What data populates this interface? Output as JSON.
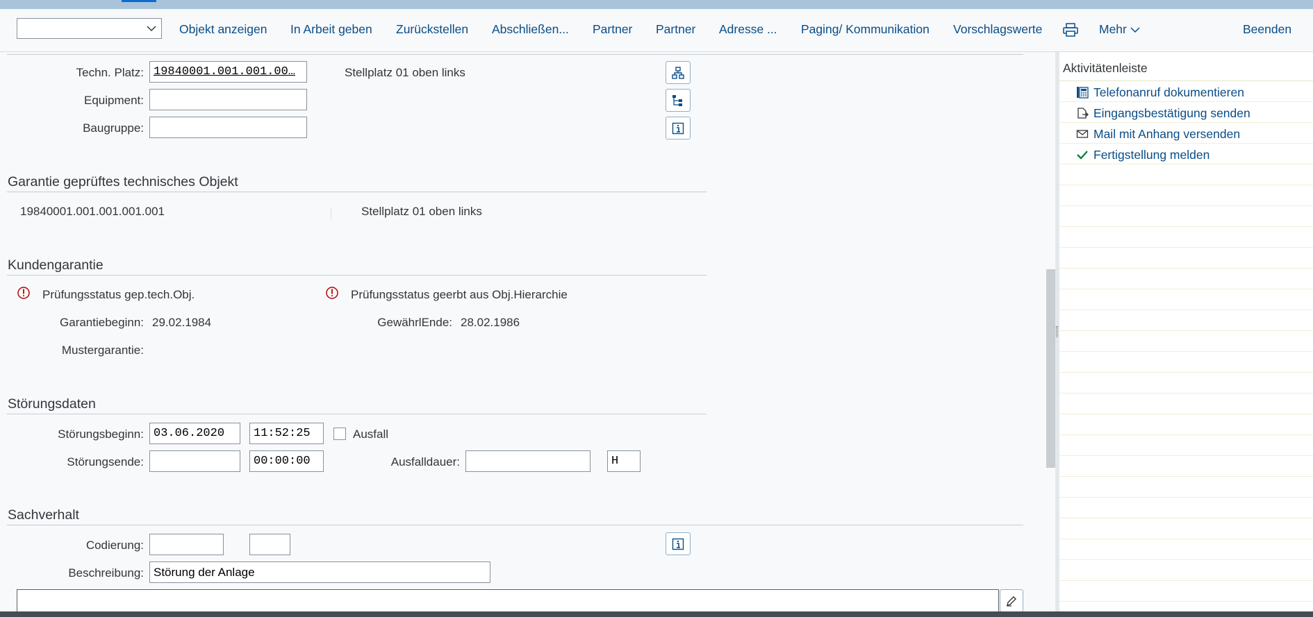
{
  "toolbar": {
    "combo_value": "",
    "buttons": [
      "Objekt anzeigen",
      "In Arbeit geben",
      "Zurückstellen",
      "Abschließen...",
      "Partner",
      "Partner",
      "Adresse ...",
      "Paging/ Kommunikation",
      "Vorschlagswerte"
    ],
    "print_icon": "printer-icon",
    "more_label": "Mehr",
    "exit_label": "Beenden"
  },
  "object": {
    "tech_platz_label": "Techn. Platz:",
    "tech_platz_value": "19840001.001.001.00…",
    "tech_platz_desc": "Stellplatz 01 oben links",
    "equipment_label": "Equipment:",
    "equipment_value": "",
    "baugruppe_label": "Baugruppe:",
    "baugruppe_value": ""
  },
  "garantie_obj": {
    "title": "Garantie geprüftes technisches Objekt",
    "object_id": "19840001.001.001.001.001",
    "object_desc": "Stellplatz 01 oben links"
  },
  "kundengarantie": {
    "title": "Kundengarantie",
    "status_left": "Prüfungsstatus gep.tech.Obj.",
    "status_right": "Prüfungsstatus geerbt aus Obj.Hierarchie",
    "garantiebeginn_label": "Garantiebeginn:",
    "garantiebeginn_value": "29.02.1984",
    "gewaehrende_label": "GewährlEnde:",
    "gewaehrende_value": "28.02.1986",
    "mustergarantie_label": "Mustergarantie:",
    "mustergarantie_value": ""
  },
  "stoerung": {
    "title": "Störungsdaten",
    "beginn_label": "Störungsbeginn:",
    "beginn_date": "03.06.2020",
    "beginn_time": "11:52:25",
    "ausfall_label": "Ausfall",
    "ausfall_checked": false,
    "ende_label": "Störungsende:",
    "ende_date": "",
    "ende_time": "00:00:00",
    "ausfalldauer_label": "Ausfalldauer:",
    "ausfalldauer_value": "",
    "ausfalldauer_unit": "H"
  },
  "sachverhalt": {
    "title": "Sachverhalt",
    "codierung_label": "Codierung:",
    "codierung_value1": "",
    "codierung_value2": "",
    "beschreibung_label": "Beschreibung:",
    "beschreibung_value": "Störung der Anlage",
    "longtext_value": ""
  },
  "sidebar": {
    "title": "Aktivitätenleiste",
    "items": [
      {
        "label": "Telefonanruf dokumentieren",
        "icon": "phone-log-icon"
      },
      {
        "label": "Eingangsbestätigung senden",
        "icon": "document-send-icon"
      },
      {
        "label": "Mail mit Anhang versenden",
        "icon": "envelope-icon"
      },
      {
        "label": "Fertigstellung melden",
        "icon": "checkmark-icon"
      }
    ]
  },
  "colors": {
    "link": "#0a4d87",
    "error": "#bb0000",
    "check": "#107e3e",
    "background": "#f7f9fb"
  }
}
